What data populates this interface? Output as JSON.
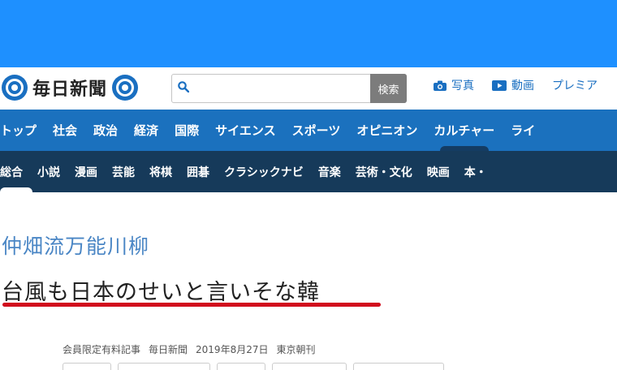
{
  "header": {
    "logo_text": "毎日新聞",
    "search": {
      "placeholder": "",
      "button_label": "検索"
    },
    "links": [
      {
        "label": "写真",
        "icon": "camera-icon"
      },
      {
        "label": "動画",
        "icon": "play-icon"
      },
      {
        "label": "プレミア",
        "icon": ""
      }
    ]
  },
  "nav_primary": [
    "トップ",
    "社会",
    "政治",
    "経済",
    "国際",
    "サイエンス",
    "スポーツ",
    "オピニオン",
    "カルチャー",
    "ライ"
  ],
  "nav_primary_active": "カルチャー",
  "nav_secondary": [
    "総合",
    "小説",
    "漫画",
    "芸能",
    "将棋",
    "囲碁",
    "クラシックナビ",
    "音楽",
    "芸術・文化",
    "映画",
    "本・"
  ],
  "nav_secondary_active": "総合",
  "article": {
    "kicker": "仲畑流万能川柳",
    "headline": "台風も日本のせいと言いそな韓",
    "meta": [
      "会員限定有料記事",
      "毎日新聞",
      "2019年8月27日",
      "東京朝刊"
    ]
  },
  "colors": {
    "top_band": "#1e90ff",
    "nav_primary": "#1b71be",
    "nav_secondary": "#163a5a",
    "accent_red": "#d10d1d",
    "kicker": "#4a86c5"
  }
}
